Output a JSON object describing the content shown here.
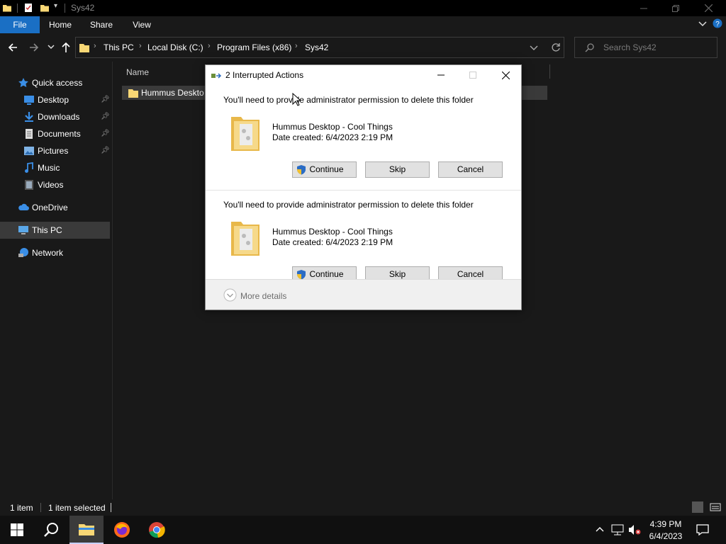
{
  "window": {
    "title": "Sys42"
  },
  "ribbon": {
    "tabs": [
      "File",
      "Home",
      "Share",
      "View"
    ]
  },
  "address": {
    "crumbs": [
      "This PC",
      "Local Disk (C:)",
      "Program Files (x86)",
      "Sys42"
    ],
    "search_placeholder": "Search Sys42"
  },
  "sidebar": {
    "quick_access": "Quick access",
    "items": [
      {
        "label": "Desktop",
        "icon": "desktop-icon",
        "pinned": true
      },
      {
        "label": "Downloads",
        "icon": "downloads-icon",
        "pinned": true
      },
      {
        "label": "Documents",
        "icon": "documents-icon",
        "pinned": true
      },
      {
        "label": "Pictures",
        "icon": "pictures-icon",
        "pinned": true
      },
      {
        "label": "Music",
        "icon": "music-icon",
        "pinned": false
      },
      {
        "label": "Videos",
        "icon": "videos-icon",
        "pinned": false
      }
    ],
    "onedrive": "OneDrive",
    "this_pc": "This PC",
    "network": "Network"
  },
  "content": {
    "column_name": "Name",
    "file": "Hummus Deskto"
  },
  "status": {
    "count": "1 item",
    "selected": "1 item selected"
  },
  "dialog": {
    "title": "2 Interrupted Actions",
    "entries": [
      {
        "message": "You'll need to provide administrator permission to delete this folder",
        "name": "Hummus Desktop - Cool Things",
        "date": "Date created: 6/4/2023 2:19 PM",
        "continue": "Continue",
        "skip": "Skip",
        "cancel": "Cancel"
      },
      {
        "message": "You'll need to provide administrator permission to delete this folder",
        "name": "Hummus Desktop - Cool Things",
        "date": "Date created: 6/4/2023 2:19 PM",
        "continue": "Continue",
        "skip": "Skip",
        "cancel": "Cancel"
      }
    ],
    "more_details": "More details"
  },
  "taskbar": {
    "time": "4:39 PM",
    "date": "6/4/2023"
  },
  "colors": {
    "accent": "#1a6fc4",
    "folder": "#f8d775",
    "background": "#191919"
  }
}
